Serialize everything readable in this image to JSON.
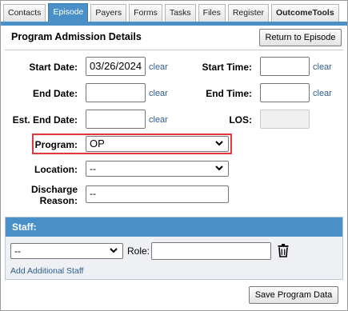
{
  "tabs": [
    {
      "label": "Contacts",
      "active": false
    },
    {
      "label": "Episode",
      "active": true
    },
    {
      "label": "Payers",
      "active": false
    },
    {
      "label": "Forms",
      "active": false
    },
    {
      "label": "Tasks",
      "active": false
    },
    {
      "label": "Files",
      "active": false
    },
    {
      "label": "Register",
      "active": false
    },
    {
      "label": "OutcomeTools",
      "active": false
    }
  ],
  "section": {
    "title": "Program Admission Details",
    "return_button": "Return to Episode"
  },
  "form": {
    "start_date": {
      "label": "Start Date:",
      "value": "03/26/2024",
      "clear": "clear"
    },
    "start_time": {
      "label": "Start Time:",
      "value": "",
      "clear": "clear"
    },
    "end_date": {
      "label": "End Date:",
      "value": "",
      "clear": "clear"
    },
    "end_time": {
      "label": "End Time:",
      "value": "",
      "clear": "clear"
    },
    "est_end_date": {
      "label": "Est. End Date:",
      "value": "",
      "clear": "clear"
    },
    "los": {
      "label": "LOS:",
      "value": ""
    },
    "program": {
      "label": "Program:",
      "value": "OP"
    },
    "location": {
      "label": "Location:",
      "value": "--"
    },
    "discharge_reason": {
      "label": "Discharge Reason:",
      "value": "--"
    }
  },
  "staff": {
    "header": "Staff:",
    "staff_select": "--",
    "role_label": "Role:",
    "role_value": "",
    "add_link": "Add Additional Staff"
  },
  "footer": {
    "save_button": "Save Program Data"
  },
  "colors": {
    "accent": "#4a90c8",
    "highlight": "#e0393b",
    "link": "#2b5d93"
  }
}
